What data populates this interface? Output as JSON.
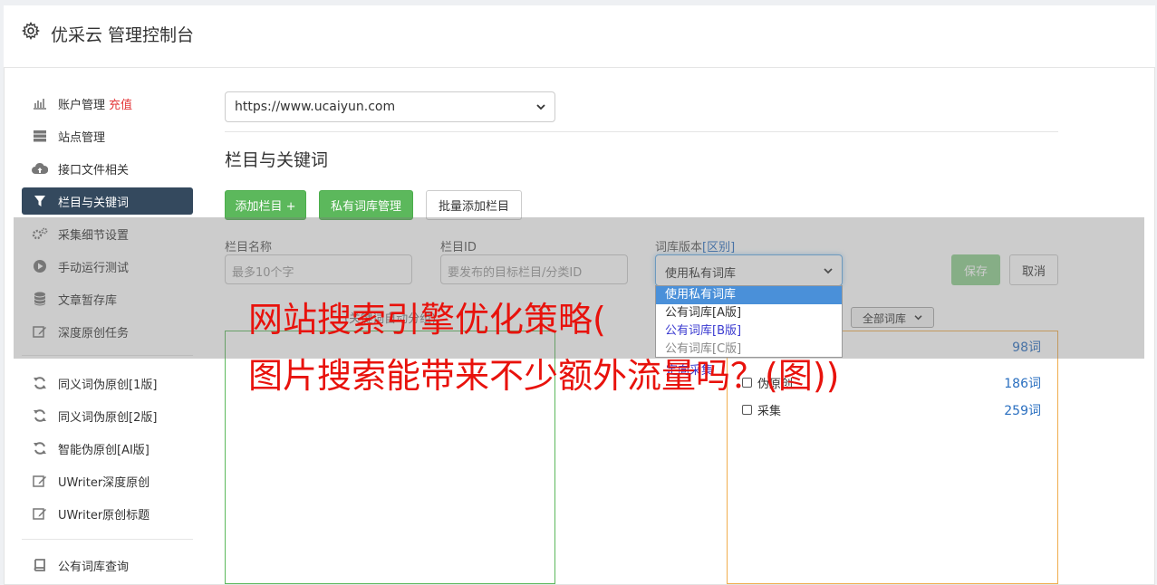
{
  "header": {
    "title": "优采云 管理控制台"
  },
  "sidebar": {
    "items": [
      {
        "label": "账户管理",
        "badge": "充值",
        "icon": "bar-chart-icon"
      },
      {
        "label": "站点管理",
        "icon": "server-icon"
      },
      {
        "label": "接口文件相关",
        "icon": "cloud-upload-icon"
      },
      {
        "label": "栏目与关键词",
        "icon": "filter-icon",
        "active": true
      },
      {
        "label": "采集细节设置",
        "icon": "cogs-icon"
      },
      {
        "label": "手动运行测试",
        "icon": "play-circle-icon"
      },
      {
        "label": "文章暂存库",
        "icon": "database-icon"
      },
      {
        "label": "深度原创任务",
        "icon": "edit-icon"
      },
      {
        "label": "同义词伪原创[1版]",
        "icon": "refresh-icon"
      },
      {
        "label": "同义词伪原创[2版]",
        "icon": "refresh-icon"
      },
      {
        "label": "智能伪原创[AI版]",
        "icon": "refresh-icon"
      },
      {
        "label": "UWriter深度原创",
        "icon": "edit-icon"
      },
      {
        "label": "UWriter原创标题",
        "icon": "edit-icon"
      },
      {
        "label": "公有词库查询",
        "icon": "book-icon"
      }
    ]
  },
  "main": {
    "site_select": "https://www.ucaiyun.com",
    "section_title": "栏目与关键词",
    "buttons": {
      "add_column": "添加栏目 +",
      "private_lib": "私有词库管理",
      "batch_add": "批量添加栏目"
    },
    "form": {
      "name_label": "栏目名称",
      "name_placeholder": "最多10个字",
      "id_label": "栏目ID",
      "id_placeholder": "要发布的目标栏目/分类ID",
      "lib_label": "词库版本",
      "lib_label_link": "[区别]",
      "lib_selected": "使用私有词库",
      "lib_options": [
        "使用私有词库",
        "公有词库[A版]",
        "公有词库[B版]",
        "公有词库[C版]"
      ],
      "save": "保存",
      "cancel": "取消"
    },
    "faint_text": "(关键词自动分组)",
    "filter_select": "全部词库",
    "link_text": "定向采集",
    "libs": [
      {
        "name": "",
        "count": "98词"
      },
      {
        "name": "伪原创",
        "count": "186词"
      },
      {
        "name": "采集",
        "count": "259词"
      }
    ]
  },
  "overlay": {
    "line1": "网站搜索引擎优化策略(",
    "line2": "图片搜索能带来不少额外流量吗？(图))"
  },
  "colors": {
    "accent_green": "#5cb85c",
    "sidebar_active": "#34495e",
    "headline_red": "#e8120c",
    "badge_red": "#e4393c"
  }
}
